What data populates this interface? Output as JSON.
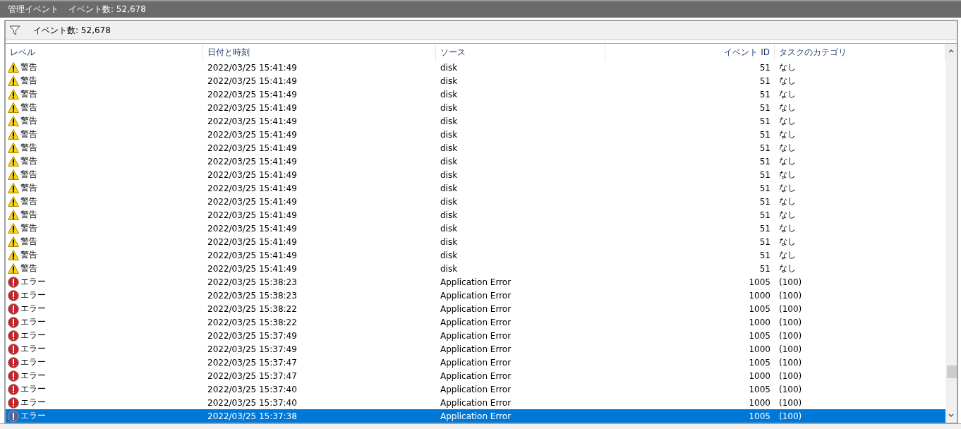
{
  "title_bar": {
    "title": "管理イベント",
    "count": "イベント数: 52,678"
  },
  "toolbar": {
    "count": "イベント数: 52,678"
  },
  "table": {
    "columns": [
      {
        "label": "レベル"
      },
      {
        "label": "日付と時刻"
      },
      {
        "label": "ソース"
      },
      {
        "label": "イベント ID"
      },
      {
        "label": "タスクのカテゴリ"
      }
    ],
    "rows": [
      {
        "kind": "warning",
        "level": "警告",
        "date": "2022/03/25 15:41:49",
        "source": "disk",
        "event_id": "51",
        "category": "なし",
        "selected": false
      },
      {
        "kind": "warning",
        "level": "警告",
        "date": "2022/03/25 15:41:49",
        "source": "disk",
        "event_id": "51",
        "category": "なし",
        "selected": false
      },
      {
        "kind": "warning",
        "level": "警告",
        "date": "2022/03/25 15:41:49",
        "source": "disk",
        "event_id": "51",
        "category": "なし",
        "selected": false
      },
      {
        "kind": "warning",
        "level": "警告",
        "date": "2022/03/25 15:41:49",
        "source": "disk",
        "event_id": "51",
        "category": "なし",
        "selected": false
      },
      {
        "kind": "warning",
        "level": "警告",
        "date": "2022/03/25 15:41:49",
        "source": "disk",
        "event_id": "51",
        "category": "なし",
        "selected": false
      },
      {
        "kind": "warning",
        "level": "警告",
        "date": "2022/03/25 15:41:49",
        "source": "disk",
        "event_id": "51",
        "category": "なし",
        "selected": false
      },
      {
        "kind": "warning",
        "level": "警告",
        "date": "2022/03/25 15:41:49",
        "source": "disk",
        "event_id": "51",
        "category": "なし",
        "selected": false
      },
      {
        "kind": "warning",
        "level": "警告",
        "date": "2022/03/25 15:41:49",
        "source": "disk",
        "event_id": "51",
        "category": "なし",
        "selected": false
      },
      {
        "kind": "warning",
        "level": "警告",
        "date": "2022/03/25 15:41:49",
        "source": "disk",
        "event_id": "51",
        "category": "なし",
        "selected": false
      },
      {
        "kind": "warning",
        "level": "警告",
        "date": "2022/03/25 15:41:49",
        "source": "disk",
        "event_id": "51",
        "category": "なし",
        "selected": false
      },
      {
        "kind": "warning",
        "level": "警告",
        "date": "2022/03/25 15:41:49",
        "source": "disk",
        "event_id": "51",
        "category": "なし",
        "selected": false
      },
      {
        "kind": "warning",
        "level": "警告",
        "date": "2022/03/25 15:41:49",
        "source": "disk",
        "event_id": "51",
        "category": "なし",
        "selected": false
      },
      {
        "kind": "warning",
        "level": "警告",
        "date": "2022/03/25 15:41:49",
        "source": "disk",
        "event_id": "51",
        "category": "なし",
        "selected": false
      },
      {
        "kind": "warning",
        "level": "警告",
        "date": "2022/03/25 15:41:49",
        "source": "disk",
        "event_id": "51",
        "category": "なし",
        "selected": false
      },
      {
        "kind": "warning",
        "level": "警告",
        "date": "2022/03/25 15:41:49",
        "source": "disk",
        "event_id": "51",
        "category": "なし",
        "selected": false
      },
      {
        "kind": "warning",
        "level": "警告",
        "date": "2022/03/25 15:41:49",
        "source": "disk",
        "event_id": "51",
        "category": "なし",
        "selected": false
      },
      {
        "kind": "error",
        "level": "エラー",
        "date": "2022/03/25 15:38:23",
        "source": "Application Error",
        "event_id": "1005",
        "category": "(100)",
        "selected": false
      },
      {
        "kind": "error",
        "level": "エラー",
        "date": "2022/03/25 15:38:23",
        "source": "Application Error",
        "event_id": "1000",
        "category": "(100)",
        "selected": false
      },
      {
        "kind": "error",
        "level": "エラー",
        "date": "2022/03/25 15:38:22",
        "source": "Application Error",
        "event_id": "1005",
        "category": "(100)",
        "selected": false
      },
      {
        "kind": "error",
        "level": "エラー",
        "date": "2022/03/25 15:38:22",
        "source": "Application Error",
        "event_id": "1000",
        "category": "(100)",
        "selected": false
      },
      {
        "kind": "error",
        "level": "エラー",
        "date": "2022/03/25 15:37:49",
        "source": "Application Error",
        "event_id": "1005",
        "category": "(100)",
        "selected": false
      },
      {
        "kind": "error",
        "level": "エラー",
        "date": "2022/03/25 15:37:49",
        "source": "Application Error",
        "event_id": "1000",
        "category": "(100)",
        "selected": false
      },
      {
        "kind": "error",
        "level": "エラー",
        "date": "2022/03/25 15:37:47",
        "source": "Application Error",
        "event_id": "1005",
        "category": "(100)",
        "selected": false
      },
      {
        "kind": "error",
        "level": "エラー",
        "date": "2022/03/25 15:37:47",
        "source": "Application Error",
        "event_id": "1000",
        "category": "(100)",
        "selected": false
      },
      {
        "kind": "error",
        "level": "エラー",
        "date": "2022/03/25 15:37:40",
        "source": "Application Error",
        "event_id": "1005",
        "category": "(100)",
        "selected": false
      },
      {
        "kind": "error",
        "level": "エラー",
        "date": "2022/03/25 15:37:40",
        "source": "Application Error",
        "event_id": "1000",
        "category": "(100)",
        "selected": false
      },
      {
        "kind": "error",
        "level": "エラー",
        "date": "2022/03/25 15:37:38",
        "source": "Application Error",
        "event_id": "1005",
        "category": "(100)",
        "selected": true
      }
    ]
  }
}
